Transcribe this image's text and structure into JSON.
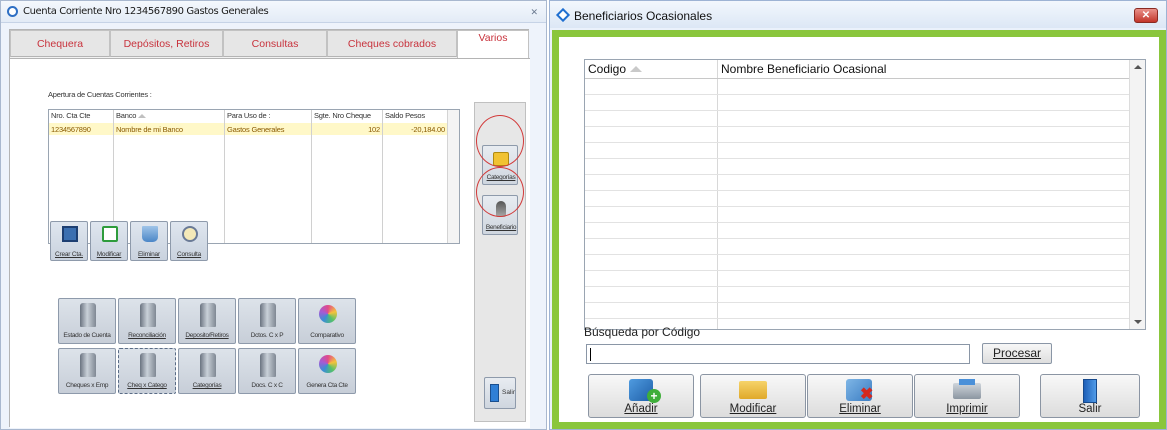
{
  "left_window": {
    "title": "Cuenta Corriente Nro 1234567890 Gastos Generales",
    "close_glyph": "✕",
    "tabs": [
      "Chequera",
      "Depósitos, Retiros",
      "Consultas",
      "Cheques cobrados",
      "Varios"
    ],
    "active_tab": "Varios",
    "section_title": "Apertura de Cuentas Corrientes :",
    "grid": {
      "columns": [
        "Nro. Cta Cte",
        "Banco",
        "Para Uso de :",
        "Sgte. Nro Cheque",
        "Saldo Pesos"
      ],
      "rows": [
        [
          "1234567890",
          "Nombre de mi Banco",
          "Gastos Generales",
          "102",
          "-20,184.00"
        ]
      ]
    },
    "small_buttons": [
      {
        "label": "Crear Cta.",
        "icon": "create-account-icon"
      },
      {
        "label": "Modificar",
        "icon": "refresh-icon"
      },
      {
        "label": "Eliminar",
        "icon": "trash-icon"
      },
      {
        "label": "Consulta",
        "icon": "magnifier-icon"
      }
    ],
    "report_buttons_row1": [
      {
        "label": "Estado de Cuenta",
        "icon": "folder-file-icon"
      },
      {
        "label": "Reconciliación",
        "icon": "folder-file-icon"
      },
      {
        "label": "Deposito/Retiros",
        "icon": "folder-file-icon"
      },
      {
        "label": "Dctos. C x P",
        "icon": "folder-file-icon"
      },
      {
        "label": "Comparativo",
        "icon": "cd-icon"
      }
    ],
    "report_buttons_row2": [
      {
        "label": "Cheques x Emp",
        "icon": "folder-file-icon"
      },
      {
        "label": "Cheq x Catego",
        "icon": "folder-file-icon"
      },
      {
        "label": "Categorías",
        "icon": "folder-file-icon"
      },
      {
        "label": "Docs. C x C",
        "icon": "folder-file-icon"
      },
      {
        "label": "Genera Cta Cte",
        "icon": "cd-icon"
      }
    ],
    "side_buttons": [
      {
        "label": "Categorías",
        "icon": "categories-icon"
      },
      {
        "label": "Beneficiario",
        "icon": "person-icon"
      }
    ],
    "exit_button": {
      "label": "Salir",
      "icon": "exit-door-icon"
    }
  },
  "right_window": {
    "title": "Beneficiarios Ocasionales",
    "close_glyph": "✕",
    "grid": {
      "columns": [
        "Codigo",
        "Nombre Beneficiario Ocasional"
      ],
      "rows": []
    },
    "search": {
      "label": "Búsqueda por Código",
      "value": "",
      "process_button": "Procesar"
    },
    "buttons": [
      {
        "label": "Añadir",
        "icon": "add-icon"
      },
      {
        "label": "Modificar",
        "icon": "edit-pencil-icon"
      },
      {
        "label": "Eliminar",
        "icon": "delete-icon"
      },
      {
        "label": "Imprimir",
        "icon": "printer-icon"
      },
      {
        "label": "Salir",
        "icon": "exit-door-icon"
      }
    ]
  },
  "colors": {
    "tab_text": "#c8323c",
    "selected_row": "#fff8c8",
    "frame_green": "#8ac63c",
    "annotation_red": "#d23a3a"
  }
}
